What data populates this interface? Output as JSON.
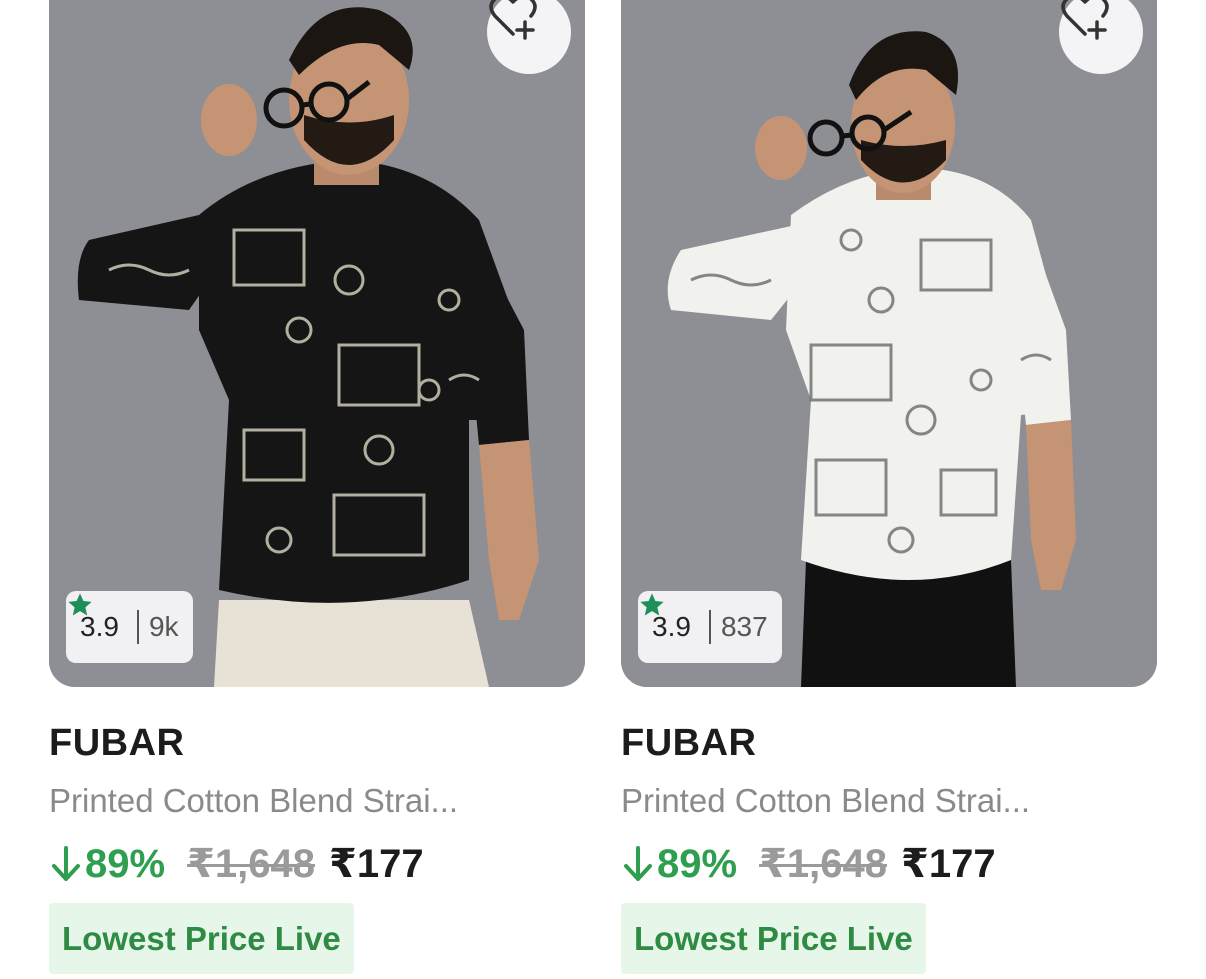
{
  "products": [
    {
      "image_alt": "Man wearing black printed shirt",
      "rating": "3.9",
      "rating_count": "9k",
      "brand": "FUBAR",
      "title": "Printed Cotton Blend Strai...",
      "discount": "89%",
      "mrp": "₹1,648",
      "price": "₹177",
      "badge": "Lowest Price Live",
      "shirt_color": "#151515",
      "pattern_color": "#cfcbb8",
      "pants_color": "#e8e2d6"
    },
    {
      "image_alt": "Man wearing white printed shirt",
      "rating": "3.9",
      "rating_count": "837",
      "brand": "FUBAR",
      "title": "Printed Cotton Blend Strai...",
      "discount": "89%",
      "mrp": "₹1,648",
      "price": "₹177",
      "badge": "Lowest Price Live",
      "shirt_color": "#f1f1ee",
      "pattern_color": "#6f7473",
      "pants_color": "#111111"
    }
  ],
  "colors": {
    "star": "#1f8f5a",
    "discount_green": "#2e9e4f",
    "badge_bg": "#e6f7ea",
    "badge_text": "#2f8a43"
  }
}
